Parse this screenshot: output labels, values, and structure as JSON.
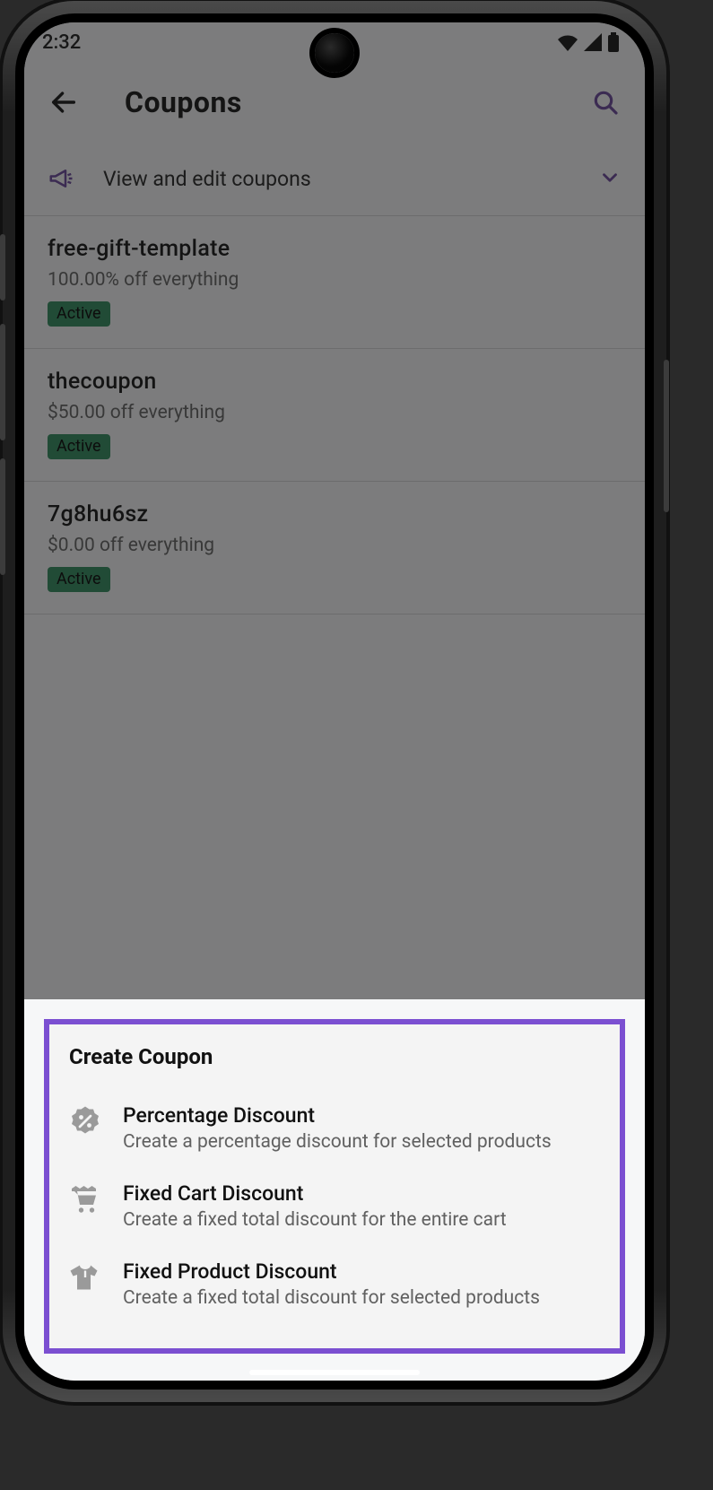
{
  "status_bar": {
    "time": "2:32"
  },
  "app_bar": {
    "title": "Coupons"
  },
  "banner": {
    "text": "View and edit coupons"
  },
  "coupons": [
    {
      "name": "free-gift-template",
      "desc": "100.00% off everything",
      "status": "Active"
    },
    {
      "name": "thecoupon",
      "desc": "$50.00 off everything",
      "status": "Active"
    },
    {
      "name": "7g8hu6sz",
      "desc": "$0.00 off everything",
      "status": "Active"
    }
  ],
  "sheet": {
    "title": "Create Coupon",
    "options": [
      {
        "title": "Percentage Discount",
        "desc": "Create a percentage discount for selected products",
        "icon": "percent-badge-icon"
      },
      {
        "title": "Fixed Cart Discount",
        "desc": "Create a fixed total discount for the entire cart",
        "icon": "cart-icon"
      },
      {
        "title": "Fixed Product Discount",
        "desc": "Create a fixed total discount for selected products",
        "icon": "hoodie-icon"
      }
    ]
  }
}
